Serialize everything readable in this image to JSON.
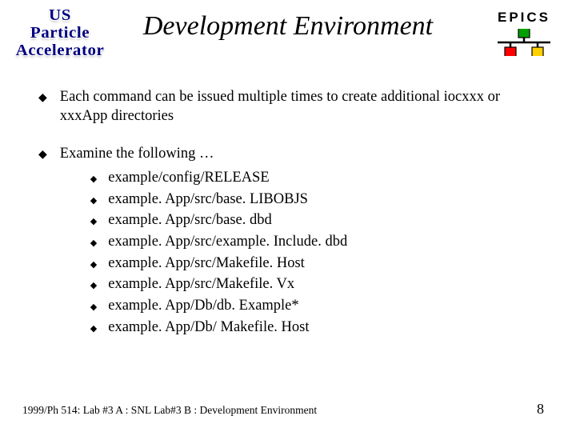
{
  "header": {
    "logo_lines": [
      "US",
      "Particle",
      "Accelerator"
    ],
    "title": "Development Environment",
    "epics_label": "EPICS",
    "epics_colors": {
      "top": "#00a000",
      "left": "#ff0000",
      "right": "#ffd000"
    }
  },
  "bullets": [
    {
      "text": "Each command can be issued multiple times to create additional iocxxx or xxxApp directories",
      "sub": []
    },
    {
      "text": "Examine the following …",
      "sub": [
        "example/config/RELEASE",
        "example. App/src/base. LIBOBJS",
        "example. App/src/base. dbd",
        "example. App/src/example. Include. dbd",
        "example. App/src/Makefile. Host",
        "example. App/src/Makefile. Vx",
        "example. App/Db/db. Example*",
        "example. App/Db/ Makefile. Host"
      ]
    }
  ],
  "footer": {
    "left": "1999/Ph 514: Lab #3 A : SNL    Lab#3 B : Development Environment",
    "right": "8"
  }
}
